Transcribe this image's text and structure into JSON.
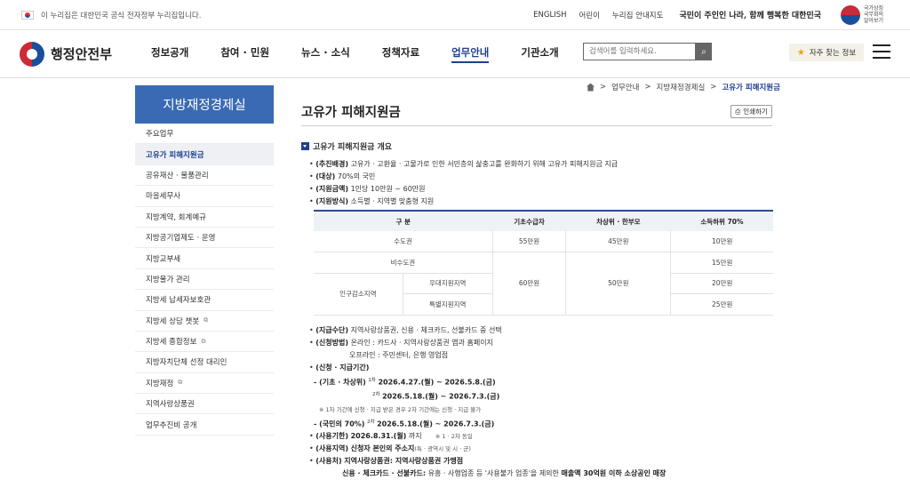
{
  "topbar": {
    "notice": "이 누리집은 대한민국 공식 전자정부 누리집입니다.",
    "links": [
      "ENGLISH",
      "어린이",
      "누리집 안내지도"
    ],
    "slogan": "국민이 주인인 나라, 함께 행복한 대한민국",
    "emblem_text": "국가상징 국무회의 알아보기"
  },
  "header": {
    "logo": "행정안전부",
    "menu": [
      "정보공개",
      "참여 · 민원",
      "뉴스 · 소식",
      "정책자료",
      "업무안내",
      "기관소개"
    ],
    "active_menu": "업무안내",
    "search_placeholder": "검색어를 입력하세요.",
    "favorite": "자주 찾는 정보"
  },
  "side": {
    "title": "지방재정경제실",
    "items": [
      "주요업무",
      "고유가 피해지원금",
      "공유재산 · 물품관리",
      "마을세무사",
      "지방계약, 회계예규",
      "지방공기업제도 · 운영",
      "지방교부세",
      "지방물가 관리",
      "지방세 납세자보호관",
      "지방세 상담 챗봇",
      "지방세 종합정보",
      "지방자치단체 선정 대리인",
      "지방재정",
      "지역사랑상품권",
      "업무추진비 공개"
    ],
    "active": "고유가 피해지원금",
    "external": [
      "지방세 상담 챗봇",
      "지방세 종합정보",
      "지방재정"
    ]
  },
  "breadcrumb": [
    "업무안내",
    "지방재정경제실",
    "고유가 피해지원금"
  ],
  "page": {
    "title": "고유가 피해지원금",
    "print": "인쇄하기"
  },
  "content": {
    "section": "고유가 피해지원금 개요",
    "items": [
      {
        "label": "(추진배경)",
        "text": "고유가 · 고환율 · 고물가로 인한 서민층의 삶충고를 완화하기 위해 고유가 피해지원금 지급"
      },
      {
        "label": "(대상)",
        "text": "70%의 국민"
      },
      {
        "label": "(지원금액)",
        "text": "1인당 10만원 ~ 60만원"
      },
      {
        "label": "(지원방식)",
        "text": "소득별 · 지역별 맞춤형 지원"
      }
    ],
    "table": {
      "headers": [
        "구 분",
        "기초수급자",
        "차상위 · 한부모",
        "소득하위 70%"
      ],
      "r1": [
        "수도권",
        "55만원",
        "45만원",
        "10만원"
      ],
      "r2": [
        "비수도권",
        "15만원"
      ],
      "group": "인구감소지역",
      "r3": [
        "우대지원지역",
        "20만원"
      ],
      "r4": [
        "특별지원지역",
        "25만원"
      ],
      "merged": [
        "60만원",
        "50만원"
      ]
    },
    "items2": [
      {
        "label": "(지급수단)",
        "text": "지역사랑상품권, 신용 · 체크카드, 선불카드 중 선택"
      },
      {
        "label": "(신청방법)",
        "text": "온라인 : 카드사 · 지역사랑상품권 앱과 홈페이지"
      }
    ],
    "offline": "오프라인 : 주민센터, 은행 영업점",
    "period_label": "(신청 · 지급기간)",
    "p1_label": "- (기초 · 차상위)",
    "p1_a_sup": "1차",
    "p1_a": "2026.4.27.(월) ~ 2026.5.8.(금)",
    "p1_b_sup": "2차",
    "p1_b": "2026.5.18.(월) ~ 2026.7.3.(금)",
    "p1_note": "※ 1차 기간에 신청 · 지급 받은 경우 2차 기간에는 신청 · 지급 불가",
    "p2_label": "- (국민의 70%)",
    "p2_sup": "2차",
    "p2": "2026.5.18.(월) ~ 2026.7.3.(금)",
    "use_label": "(사용기한)",
    "use": "2026.8.31.(월)",
    "use_tail": "까지",
    "use_note": "※ 1 · 2차 동일",
    "place_label": "(사용지역)",
    "place": "신청자 본인의 주소지",
    "place_tail": "(특 · 광역시 및 시 · 군)",
    "shop_label": "(사용처)",
    "shop": "지역사랑상품권: 지역사랑상품권 가맹점",
    "card_label": "신용 · 체크카드 · 선불카드:",
    "card": "유흥 · 사행업종 등 '사용불가 업종'을 제외한",
    "card_b": "매출액 30억원 이하 소상공인 매장"
  },
  "colors": {
    "accent": "#1d3f8f",
    "side_title_bg": "#3a6ab4"
  }
}
